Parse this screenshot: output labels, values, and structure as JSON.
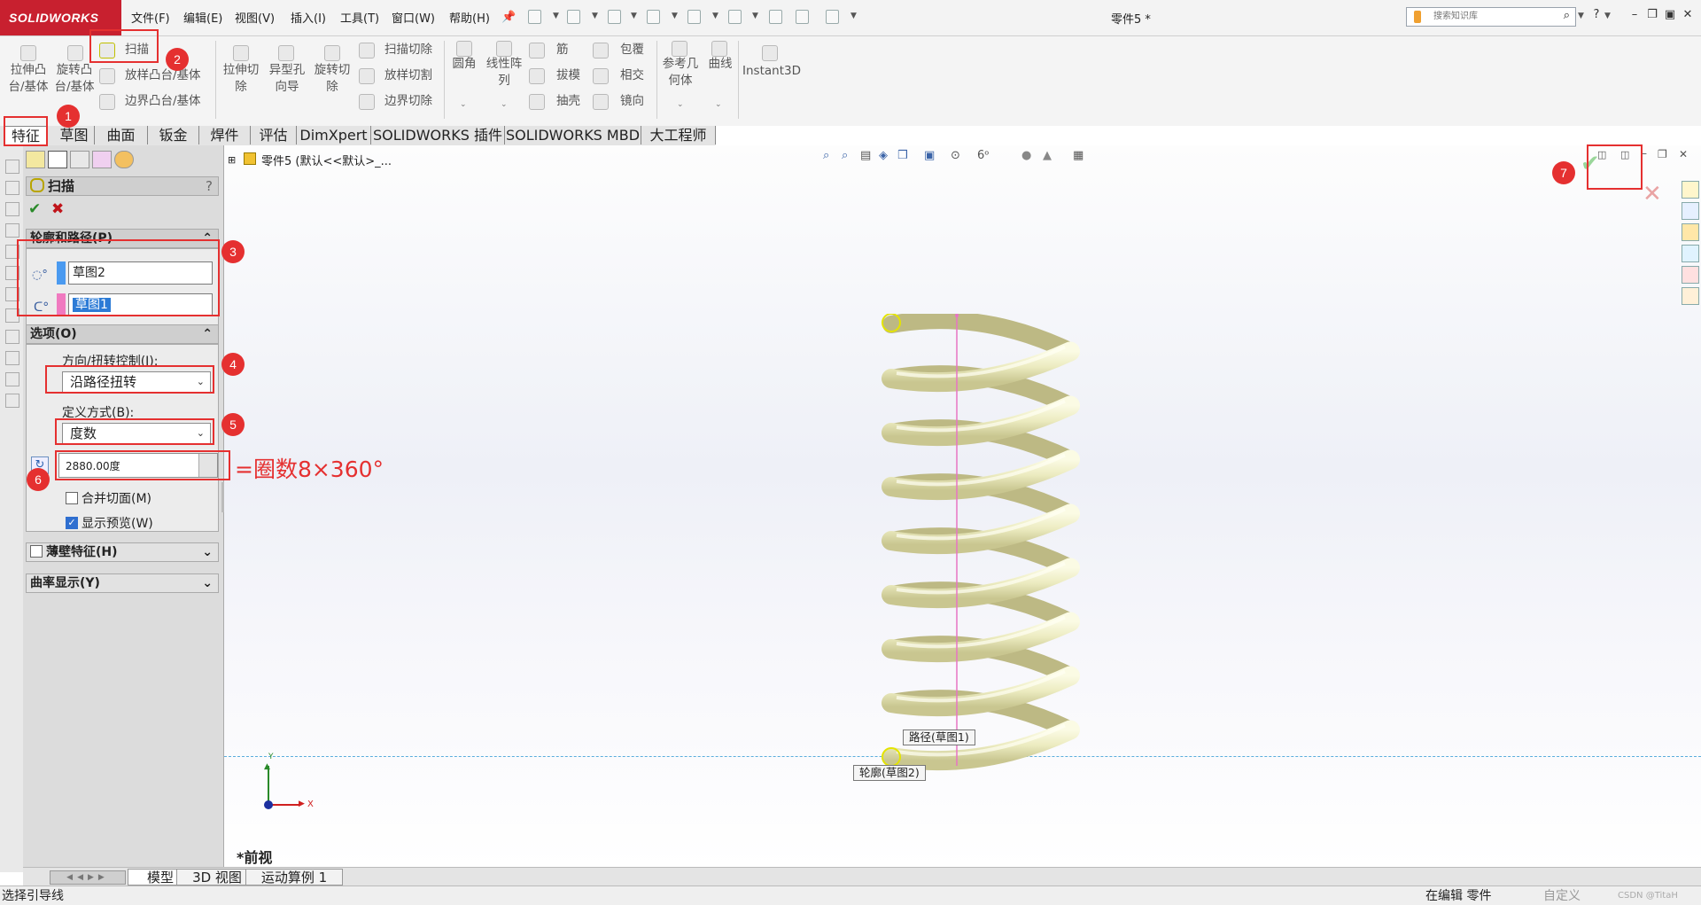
{
  "app": {
    "brand": "SOLIDWORKS",
    "document_title": "零件5 *"
  },
  "menu": [
    "文件(F)",
    "编辑(E)",
    "视图(V)",
    "插入(I)",
    "工具(T)",
    "窗口(W)",
    "帮助(H)"
  ],
  "search": {
    "placeholder": "搜索知识库"
  },
  "features_toolbar": {
    "extrude_boss": "拉伸凸台/基体",
    "revolve_boss": "旋转凸台/基体",
    "sweep": "扫描",
    "loft_boss": "放样凸台/基体",
    "boundary_boss": "边界凸台/基体",
    "extrude_cut": "拉伸切除",
    "hole_wizard": "异型孔向导",
    "revolve_cut": "旋转切除",
    "swept_cut": "扫描切除",
    "lofted_cut": "放样切割",
    "boundary_cut": "边界切除",
    "fillet": "圆角",
    "linear_pattern": "线性阵列",
    "rib": "筋",
    "draft": "拔模",
    "shell": "抽壳",
    "wrap": "包覆",
    "intersect": "相交",
    "mirror": "镜向",
    "reference_geometry": "参考几何体",
    "curves": "曲线",
    "instant3d": "Instant3D"
  },
  "tabs": [
    "特征",
    "草图",
    "曲面",
    "钣金",
    "焊件",
    "评估",
    "DimXpert",
    "SOLIDWORKS 插件",
    "SOLIDWORKS MBD",
    "大工程师"
  ],
  "feature_tree": {
    "root": "零件5  (默认<<默认>_..."
  },
  "property_manager": {
    "title": "扫描",
    "help": "?",
    "profile_section": {
      "title": "轮廓和路径(P)",
      "profile": "草图2",
      "path": "草图1"
    },
    "options_section": {
      "title": "选项(O)",
      "orientation_label": "方向/扭转控制(I):",
      "orientation_value": "沿路径扭转",
      "define_by_label": "定义方式(B):",
      "define_by_value": "度数",
      "twist_value": "2880.00度",
      "merge_tangent_faces": "合并切面(M)",
      "merge_tangent_checked": false,
      "show_preview": "显示预览(W)",
      "show_preview_checked": true
    },
    "thin_feature": "薄壁特征(H)",
    "curvature_display": "曲率显示(Y)"
  },
  "annotations": {
    "badges": [
      "1",
      "2",
      "3",
      "4",
      "5",
      "6",
      "7"
    ],
    "formula": "=圈数8×360°"
  },
  "viewport": {
    "path_tag": "路径(草图1)",
    "profile_tag": "轮廓(草图2)",
    "view_label": "*前视",
    "axis_y": "Y",
    "axis_x": "X",
    "spring_color": "#ecebc0",
    "path_color": "#e774c4"
  },
  "bottom_tabs": [
    "模型",
    "3D 视图",
    "运动算例 1"
  ],
  "status": {
    "left": "选择引导线",
    "mode": "在编辑 零件",
    "custom": "自定义",
    "watermark": "CSDN @TitaH"
  }
}
